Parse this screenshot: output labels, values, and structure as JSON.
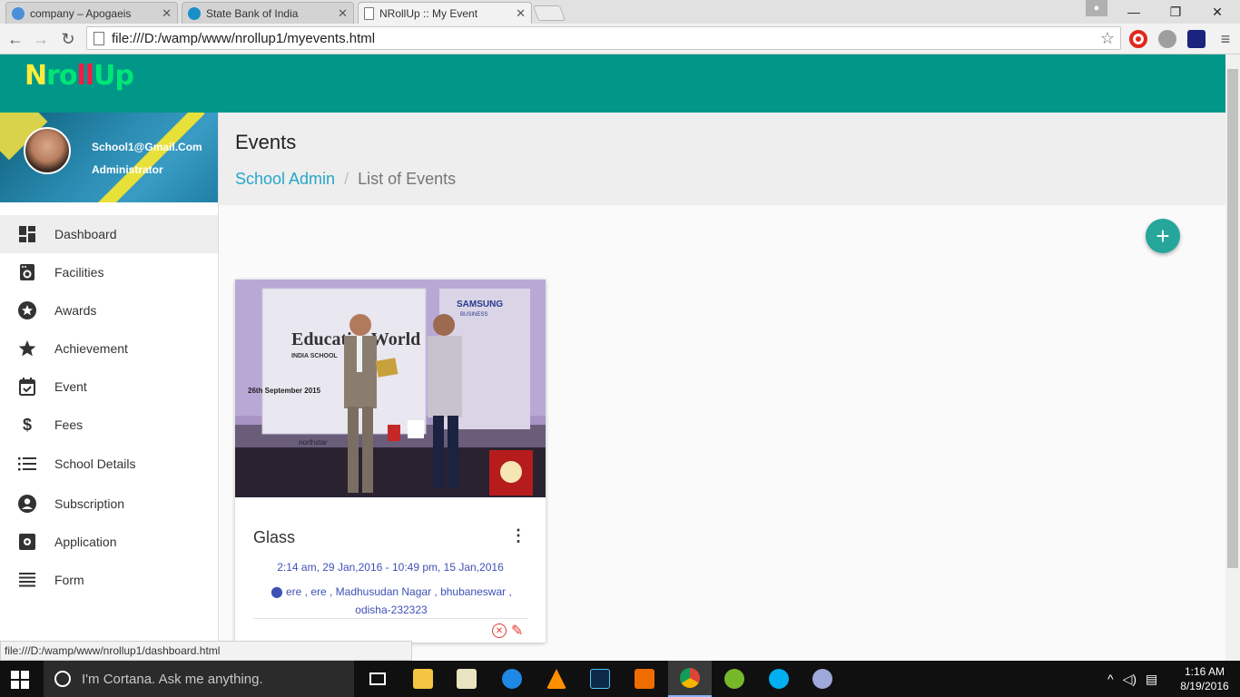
{
  "browser": {
    "tabs": [
      {
        "title": "company – Apogaeis",
        "active": false
      },
      {
        "title": "State Bank of India",
        "active": false
      },
      {
        "title": "NRollUp :: My Event",
        "active": true
      }
    ],
    "url": "file:///D:/wamp/www/nrollup1/myevents.html",
    "status_url": "file:///D:/wamp/www/nrollup1/dashboard.html"
  },
  "app": {
    "logo": {
      "part1": "N",
      "part2": "ro",
      "part3": "ll",
      "part4": "Up"
    },
    "profile": {
      "email": "School1@Gmail.Com",
      "role": "Administrator"
    },
    "nav": [
      {
        "label": "Dashboard",
        "icon": "dashboard-icon"
      },
      {
        "label": "Facilities",
        "icon": "washing-machine-icon"
      },
      {
        "label": "Awards",
        "icon": "star-circle-icon"
      },
      {
        "label": "Achievement",
        "icon": "star-icon"
      },
      {
        "label": "Event",
        "icon": "calendar-check-icon"
      },
      {
        "label": "Fees",
        "icon": "dollar-icon"
      },
      {
        "label": "School Details",
        "icon": "list-icon"
      },
      {
        "label": "Subscription",
        "icon": "account-circle-icon"
      },
      {
        "label": "Application",
        "icon": "settings-box-icon"
      },
      {
        "label": "Form",
        "icon": "lines-icon"
      }
    ],
    "header": {
      "title": "Events",
      "breadcrumb_root": "School Admin",
      "breadcrumb_current": "List of Events"
    },
    "card": {
      "title": "Glass",
      "datetime": "2:14 am, 29 Jan,2016 - 10:49 pm, 15 Jan,2016",
      "address": "ere , ere , Madhusudan Nagar , bhubaneswar , odisha-232323",
      "image_text": {
        "brand": "SAMSUNG",
        "brand_sub": "BUSINESS",
        "headline": "EducationWorld",
        "subline": "INDIA SCHOOL",
        "date_banner": "26th September 2015",
        "sponsor": "northstar"
      }
    },
    "colors": {
      "appbar": "#009688",
      "accent": "#26a69a",
      "link": "#26a6c9",
      "danger": "#e53935"
    }
  },
  "taskbar": {
    "cortana_placeholder": "I'm Cortana. Ask me anything.",
    "time": "1:16 AM",
    "date": "8/19/2016"
  }
}
